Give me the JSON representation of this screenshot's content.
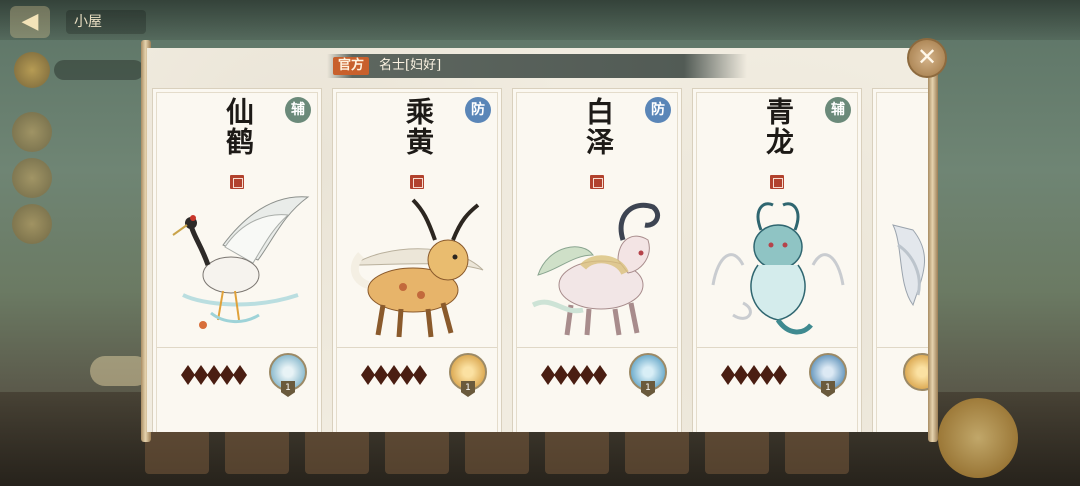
{
  "header": {
    "official_tag": "官方",
    "creator_name": "名士[妇好]"
  },
  "cards": [
    {
      "name": "仙鹤",
      "role": "辅",
      "role_color": "#6b8a7a",
      "stars": 5,
      "skill_level": "1",
      "skill_color": "#7fb3c9"
    },
    {
      "name": "乘黄",
      "role": "防",
      "role_color": "#5a86b8",
      "stars": 5,
      "skill_level": "1",
      "skill_color": "#d8a248"
    },
    {
      "name": "白泽",
      "role": "防",
      "role_color": "#5a86b8",
      "stars": 5,
      "skill_level": "1",
      "skill_color": "#5fa3c6"
    },
    {
      "name": "青龙",
      "role": "辅",
      "role_color": "#6b8a7a",
      "stars": 5,
      "skill_level": "1",
      "skill_color": "#5a8fb8"
    }
  ],
  "close_symbol": "✕",
  "background": {
    "back_symbol": "◀",
    "title": "小屋"
  }
}
